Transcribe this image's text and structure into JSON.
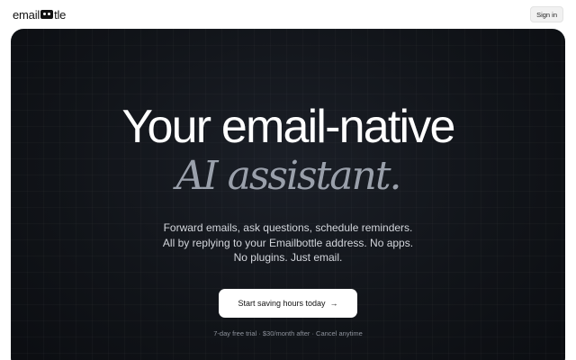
{
  "nav": {
    "logo_text_left": "email",
    "logo_text_right": "tle",
    "signin_label": "Sign in"
  },
  "hero": {
    "headline": "Your email-native",
    "headline_italic": "AI assistant.",
    "subtitle_lines": [
      "Forward emails, ask questions, schedule reminders.",
      "All by replying to your Emailbottle address. No apps.",
      "No plugins. Just email."
    ],
    "cta_label": "Start saving hours today",
    "cta_icon": "arrow-right-icon",
    "fineprint": "7-day free trial · $30/month after · Cancel anytime"
  },
  "colors": {
    "hero_background": "#111419",
    "headline": "#ffffff",
    "headline_italic": "#9aa0ab",
    "cta_background": "#ffffff"
  }
}
